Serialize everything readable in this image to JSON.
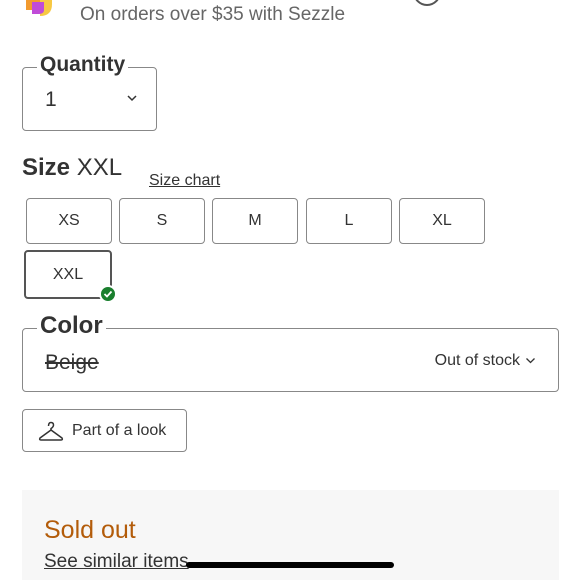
{
  "sezzle": {
    "text": "On orders over $35 with Sezzle",
    "logo_icon": "sezzle-logo",
    "info_icon": "info-icon"
  },
  "quantity": {
    "label": "Quantity",
    "value": "1"
  },
  "size": {
    "label": "Size",
    "selected": "XXL",
    "chart_link": "Size chart",
    "options": [
      "XS",
      "S",
      "M",
      "L",
      "XL",
      "XXL"
    ]
  },
  "color": {
    "label": "Color",
    "value": "Beige",
    "status": "Out of stock"
  },
  "look": {
    "label": "Part of a look",
    "icon": "hanger-icon"
  },
  "availability": {
    "title": "Sold out",
    "link": "See similar items",
    "title_color": "#b35c0a"
  },
  "colors": {
    "selected_check": "#1a7f2e"
  }
}
